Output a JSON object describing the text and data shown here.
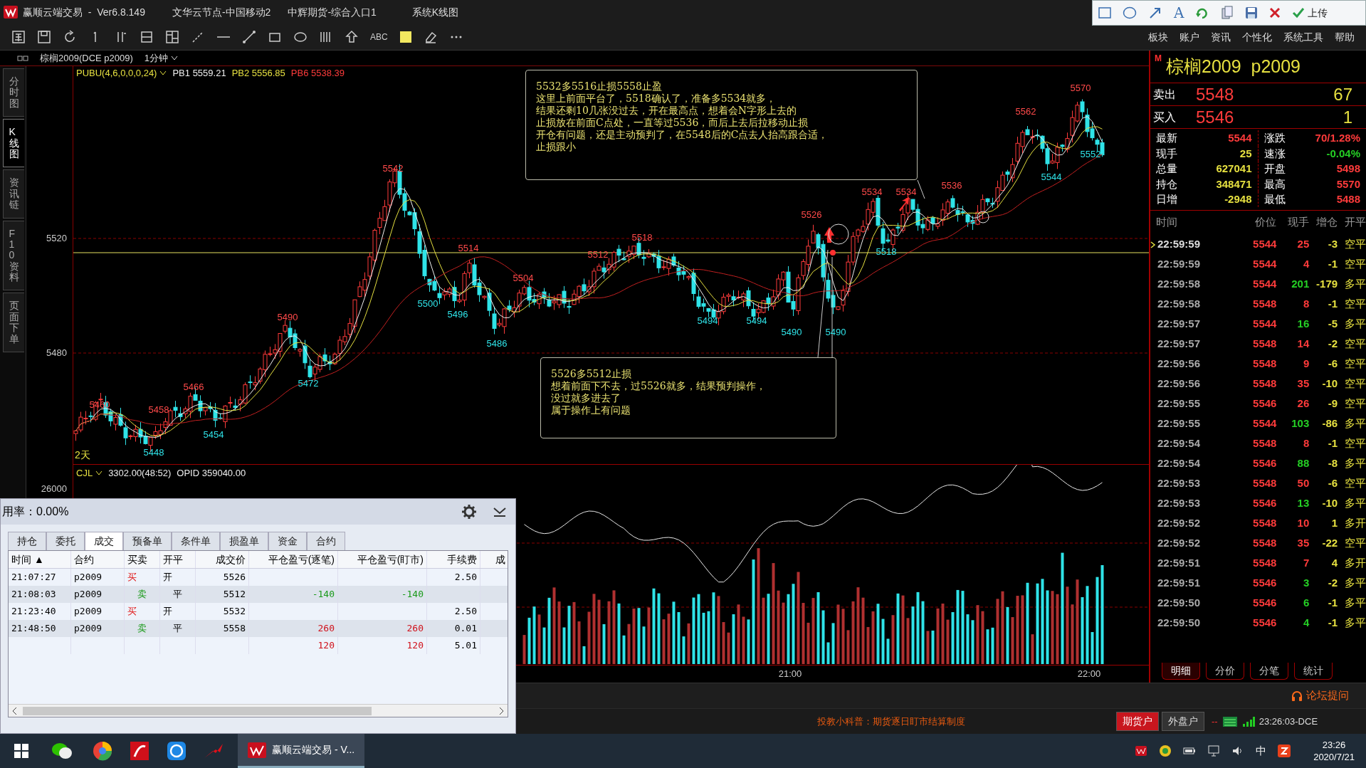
{
  "title_bar": {
    "texts": [
      "赢顺云端交易  -  Ver6.8.149",
      "文华云节点-中国移动2",
      "中辉期货-综合入口1",
      "系统K线图"
    ],
    "font_tool": "A",
    "upload": "上传"
  },
  "toolbar": {
    "text_tool": "ABC",
    "menu": [
      "板块",
      "账户",
      "资讯",
      "个性化",
      "系统工具",
      "帮助"
    ]
  },
  "chart_header": {
    "symbol": "棕榈2009(DCE p2009)",
    "period": "1分钟"
  },
  "side_tabs": [
    {
      "label": "分时图",
      "selected": false
    },
    {
      "label": "K线图",
      "selected": true
    },
    {
      "label": "资讯链",
      "selected": false
    },
    {
      "label": "F10资料",
      "selected": false
    },
    {
      "label": "页面下单",
      "selected": false
    }
  ],
  "price_chart": {
    "indicator": "PUBU(4,6,0,0,0,24)",
    "lines": [
      {
        "label": "PB1 5559.21",
        "kind": "fast"
      },
      {
        "label": "PB2 5556.85",
        "kind": "mid"
      },
      {
        "label": "PB6 5538.39",
        "kind": "slow"
      }
    ],
    "y_labels": [
      "5520",
      "5480"
    ],
    "range_label": "2天",
    "price_marks": [
      {
        "text": "5460",
        "kind": "high"
      },
      {
        "text": "5448",
        "kind": "low"
      },
      {
        "text": "5458",
        "kind": "high"
      },
      {
        "text": "5466",
        "kind": "high"
      },
      {
        "text": "5454",
        "kind": "low"
      },
      {
        "text": "5490",
        "kind": "high"
      },
      {
        "text": "5472",
        "kind": "low"
      },
      {
        "text": "5542",
        "kind": "high"
      },
      {
        "text": "5500",
        "kind": "low"
      },
      {
        "text": "5514",
        "kind": "high"
      },
      {
        "text": "5496",
        "kind": "low"
      },
      {
        "text": "5486",
        "kind": "low"
      },
      {
        "text": "5504",
        "kind": "high"
      },
      {
        "text": "5512",
        "kind": "high"
      },
      {
        "text": "5518",
        "kind": "high"
      },
      {
        "text": "5494",
        "kind": "low"
      },
      {
        "text": "5494",
        "kind": "low"
      },
      {
        "text": "5490",
        "kind": "low"
      },
      {
        "text": "5526",
        "kind": "high"
      },
      {
        "text": "5490",
        "kind": "low"
      },
      {
        "text": "5534",
        "kind": "high"
      },
      {
        "text": "5518",
        "kind": "low"
      },
      {
        "text": "5534",
        "kind": "high"
      },
      {
        "text": "5536",
        "kind": "high"
      },
      {
        "text": "5562",
        "kind": "high"
      },
      {
        "text": "5544",
        "kind": "low"
      },
      {
        "text": "5570",
        "kind": "high"
      },
      {
        "text": "5552",
        "kind": "low"
      }
    ],
    "notes": [
      {
        "lines": [
          "5532多5516止损5558止盈",
          "这里上前面平台了，5518确认了，准备多5534就多，",
          "结果还剩10几张没过去，开在最高点，想着会N字形上去的",
          "止损放在前面C点处，一直等过5536，而后上去后拉移动止损",
          "开仓有问题，还是主动预判了，在5548后的C点去人抬高跟合适，",
          "止损跟小"
        ]
      },
      {
        "lines": [
          "5526多5512止损",
          "想着前面下不去，过5526就多，结果预判操作，",
          "没过就多进去了",
          "属于操作上有问题"
        ]
      }
    ]
  },
  "volume_chart": {
    "indicator": "CJL",
    "volume": "3302.00(48:52)",
    "open_interest": "OPID 359040.00",
    "y_label": "26000",
    "time_labels": [
      "21:00",
      "22:00"
    ]
  },
  "quote": {
    "badge": "M",
    "title": "棕榈2009  p2009",
    "ask": {
      "label": "卖出",
      "price": "5548",
      "volume": "67"
    },
    "bid": {
      "label": "买入",
      "price": "5546",
      "volume": "1"
    },
    "stats": [
      {
        "label": "最新",
        "value": "5544",
        "kind": "up"
      },
      {
        "label": "涨跌",
        "value": "70/1.28%",
        "kind": "up"
      },
      {
        "label": "现手",
        "value": "25",
        "kind": "flat"
      },
      {
        "label": "速涨",
        "value": "-0.04%",
        "kind": "down"
      },
      {
        "label": "总量",
        "value": "627041",
        "kind": "flat"
      },
      {
        "label": "开盘",
        "value": "5498",
        "kind": "up"
      },
      {
        "label": "持仓",
        "value": "348471",
        "kind": "flat"
      },
      {
        "label": "最高",
        "value": "5570",
        "kind": "up"
      },
      {
        "label": "日增",
        "value": "-2948",
        "kind": "flat"
      },
      {
        "label": "最低",
        "value": "5488",
        "kind": "up"
      }
    ],
    "tick_columns": [
      "时间",
      "价位",
      "现手",
      "增仓",
      "开平"
    ],
    "ticks": [
      {
        "time": "22:59:59",
        "price": "5544",
        "volume": "25",
        "change": "-3",
        "type": "空平",
        "kind": "up",
        "selected": true
      },
      {
        "time": "22:59:59",
        "price": "5544",
        "volume": "4",
        "change": "-1",
        "type": "空平",
        "kind": "up",
        "selected": false
      },
      {
        "time": "22:59:58",
        "price": "5544",
        "volume": "201",
        "change": "-179",
        "type": "多平",
        "kind": "down",
        "selected": false
      },
      {
        "time": "22:59:58",
        "price": "5548",
        "volume": "8",
        "change": "-1",
        "type": "空平",
        "kind": "up",
        "selected": false
      },
      {
        "time": "22:59:57",
        "price": "5544",
        "volume": "16",
        "change": "-5",
        "type": "多平",
        "kind": "down",
        "selected": false
      },
      {
        "time": "22:59:57",
        "price": "5548",
        "volume": "14",
        "change": "-2",
        "type": "空平",
        "kind": "up",
        "selected": false
      },
      {
        "time": "22:59:56",
        "price": "5548",
        "volume": "9",
        "change": "-6",
        "type": "空平",
        "kind": "up",
        "selected": false
      },
      {
        "time": "22:59:56",
        "price": "5548",
        "volume": "35",
        "change": "-10",
        "type": "空平",
        "kind": "up",
        "selected": false
      },
      {
        "time": "22:59:55",
        "price": "5546",
        "volume": "26",
        "change": "-9",
        "type": "空平",
        "kind": "up",
        "selected": false
      },
      {
        "time": "22:59:55",
        "price": "5544",
        "volume": "103",
        "change": "-86",
        "type": "多平",
        "kind": "down",
        "selected": false
      },
      {
        "time": "22:59:54",
        "price": "5548",
        "volume": "8",
        "change": "-1",
        "type": "空平",
        "kind": "up",
        "selected": false
      },
      {
        "time": "22:59:54",
        "price": "5546",
        "volume": "88",
        "change": "-8",
        "type": "多平",
        "kind": "down",
        "selected": false
      },
      {
        "time": "22:59:53",
        "price": "5548",
        "volume": "50",
        "change": "-6",
        "type": "空平",
        "kind": "up",
        "selected": false
      },
      {
        "time": "22:59:53",
        "price": "5546",
        "volume": "13",
        "change": "-10",
        "type": "多平",
        "kind": "down",
        "selected": false
      },
      {
        "time": "22:59:52",
        "price": "5548",
        "volume": "10",
        "change": "1",
        "type": "多开",
        "kind": "up",
        "selected": false
      },
      {
        "time": "22:59:52",
        "price": "5548",
        "volume": "35",
        "change": "-22",
        "type": "空平",
        "kind": "up",
        "selected": false
      },
      {
        "time": "22:59:51",
        "price": "5548",
        "volume": "7",
        "change": "4",
        "type": "多开",
        "kind": "up",
        "selected": false
      },
      {
        "time": "22:59:51",
        "price": "5546",
        "volume": "3",
        "change": "-2",
        "type": "多平",
        "kind": "down",
        "selected": false
      },
      {
        "time": "22:59:50",
        "price": "5546",
        "volume": "6",
        "change": "-1",
        "type": "多平",
        "kind": "down",
        "selected": false
      },
      {
        "time": "22:59:50",
        "price": "5546",
        "volume": "4",
        "change": "-1",
        "type": "多平",
        "kind": "down",
        "selected": false
      }
    ],
    "tabs": [
      {
        "label": "明细",
        "selected": true
      },
      {
        "label": "分价",
        "selected": false
      },
      {
        "label": "分笔",
        "selected": false
      },
      {
        "label": "统计",
        "selected": false
      }
    ]
  },
  "trade_panel": {
    "usage": "用率：0.00%",
    "tabs": [
      {
        "label": "持仓",
        "selected": false
      },
      {
        "label": "委托",
        "selected": false
      },
      {
        "label": "成交",
        "selected": true
      },
      {
        "label": "预备单",
        "selected": false
      },
      {
        "label": "条件单",
        "selected": false
      },
      {
        "label": "损盈单",
        "selected": false
      },
      {
        "label": "资金",
        "selected": false
      },
      {
        "label": "合约",
        "selected": false
      }
    ],
    "columns": [
      "时间 ▲",
      "合约",
      "买卖",
      "开平",
      "成交价",
      "平仓盈亏(逐笔)",
      "平仓盈亏(盯市)",
      "手续费",
      "成"
    ],
    "rows": [
      {
        "time": "21:07:27",
        "contract": "p2009",
        "side": "买",
        "action": "开",
        "price": "5526",
        "fee": "2.50",
        "kind": "buy"
      },
      {
        "time": "21:08:03",
        "contract": "p2009",
        "side": "卖",
        "action": "平",
        "price": "5512",
        "pnl_trade": "-140",
        "pnl_mark": "-140",
        "kind": "loss"
      },
      {
        "time": "21:23:40",
        "contract": "p2009",
        "side": "买",
        "action": "开",
        "price": "5532",
        "fee": "2.50",
        "kind": "buy"
      },
      {
        "time": "21:48:50",
        "contract": "p2009",
        "side": "卖",
        "action": "平",
        "price": "5558",
        "pnl_trade": "260",
        "pnl_mark": "260",
        "fee": "0.01",
        "kind": "profit"
      },
      {
        "pnl_trade": "120",
        "pnl_mark": "120",
        "fee": "5.01",
        "kind": "total"
      }
    ]
  },
  "status": {
    "forum": "论坛提问",
    "tip": "投教小科普：期货逐日盯市结算制度",
    "accounts": [
      {
        "label": "期货户",
        "selected": true
      },
      {
        "label": "外盘户",
        "selected": false
      }
    ],
    "dashes": "--",
    "clock": "23:26:03-DCE"
  },
  "taskbar": {
    "active_window": "赢顺云端交易 - V...",
    "ime": "中",
    "time": "23:26",
    "date": "2020/7/21"
  }
}
